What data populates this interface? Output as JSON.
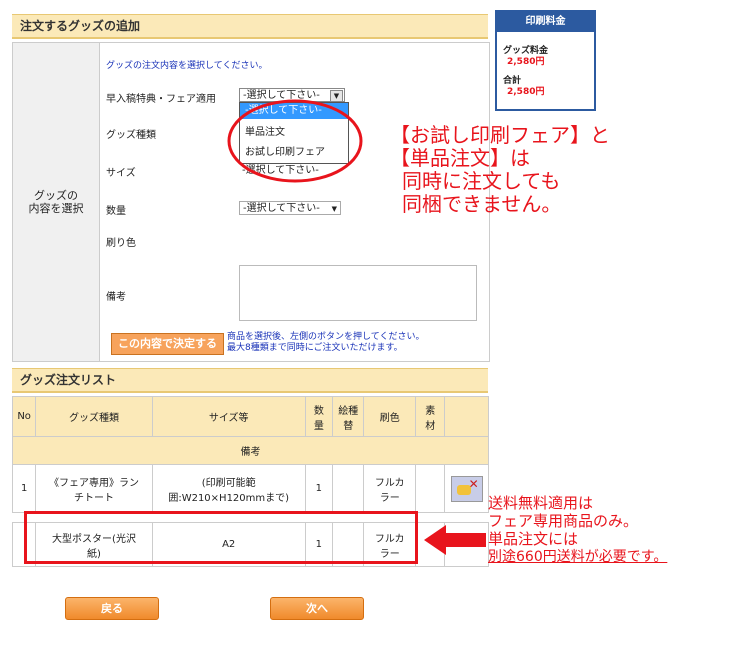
{
  "add_section": {
    "title": "注文するグッズの追加",
    "label_select_line1": "グッズの",
    "label_select_line2": "内容を選択",
    "instruction": "グッズの注文内容を選択してください。",
    "fields": {
      "early": {
        "label": "早入稿特典・フェア適用",
        "value": "-選択して下さい-"
      },
      "goods_type": {
        "label": "グッズ種類"
      },
      "size": {
        "label": "サイズ",
        "value": "-選択して下さい-"
      },
      "quantity": {
        "label": "数量",
        "value": "-選択して下さい-"
      },
      "print_color": {
        "label": "刷り色"
      },
      "remarks": {
        "label": "備考",
        "value": ""
      }
    },
    "dropdown": {
      "highlighted": "-選択して下さい-",
      "options": [
        "単品注文",
        "お試し印刷フェア"
      ]
    },
    "decide_button": "この内容で決定する",
    "decide_note_line1": "商品を選択後、左側のボタンを押してください。",
    "decide_note_line2": "最大8種類まで同時にご注文いただけます。"
  },
  "price_box": {
    "title": "印刷料金",
    "goods_label": "グッズ料金",
    "goods_value": "2,580円",
    "total_label": "合計",
    "total_value": "2,580円"
  },
  "list_section": {
    "title": "グッズ注文リスト",
    "headers": {
      "no": "No",
      "type": "グッズ種類",
      "size": "サイズ等",
      "qty_1": "数",
      "qty_2": "量",
      "picture_1": "絵種",
      "picture_2": "替",
      "color": "刷色",
      "material_1": "素",
      "material_2": "材",
      "remarks": "備考"
    },
    "rows": [
      {
        "no": "1",
        "type_1": "《フェア専用》ラン",
        "type_2": "チトート",
        "size_1": "(印刷可能範",
        "size_2": "囲:W210×H120mmまで)",
        "qty": "1",
        "color_1": "フルカ",
        "color_2": "ラー"
      },
      {
        "no": "",
        "type_1": "大型ポスター(光沢",
        "type_2": "紙)",
        "size_1": "A2",
        "size_2": "",
        "qty": "1",
        "color_1": "フルカ",
        "color_2": "ラー"
      }
    ]
  },
  "callout_main": {
    "line1": "【お試し印刷フェア】と",
    "line2": "【単品注文】は",
    "line3": "同時に注文しても",
    "line4": "同梱できません。"
  },
  "callout_shipping": {
    "line1": "送料無料適用は",
    "line2": "フェア専用商品のみ。",
    "line3": "単品注文には",
    "line4": "別途660円送料が必要です。"
  },
  "nav": {
    "back": "戻る",
    "next": "次へ"
  },
  "colors": {
    "accent_red": "#e8141c",
    "header_bg": "#fbe9b8",
    "link_blue": "#1a33b8",
    "button_orange": "#f08a2b"
  }
}
